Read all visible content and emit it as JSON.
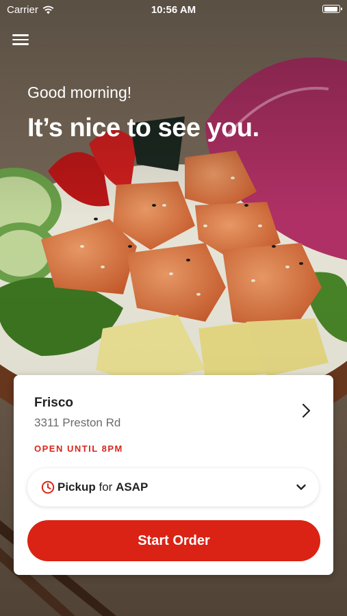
{
  "status_bar": {
    "carrier": "Carrier",
    "time": "10:56 AM",
    "battery_level": 0.95
  },
  "hero": {
    "greeting": "Good morning!",
    "headline": "It’s nice to see you."
  },
  "store": {
    "name": "Frisco",
    "address": "3311 Preston Rd",
    "hours": "OPEN UNTIL 8PM"
  },
  "order_mode": {
    "method": "Pickup",
    "connector": "for",
    "time": "ASAP"
  },
  "actions": {
    "start_order": "Start Order"
  },
  "colors": {
    "accent": "#da2314",
    "open_text": "#d8271b"
  },
  "icons": [
    "wifi-icon",
    "battery-icon",
    "hamburger-menu-icon",
    "chevron-right-icon",
    "clock-icon",
    "chevron-down-icon"
  ]
}
